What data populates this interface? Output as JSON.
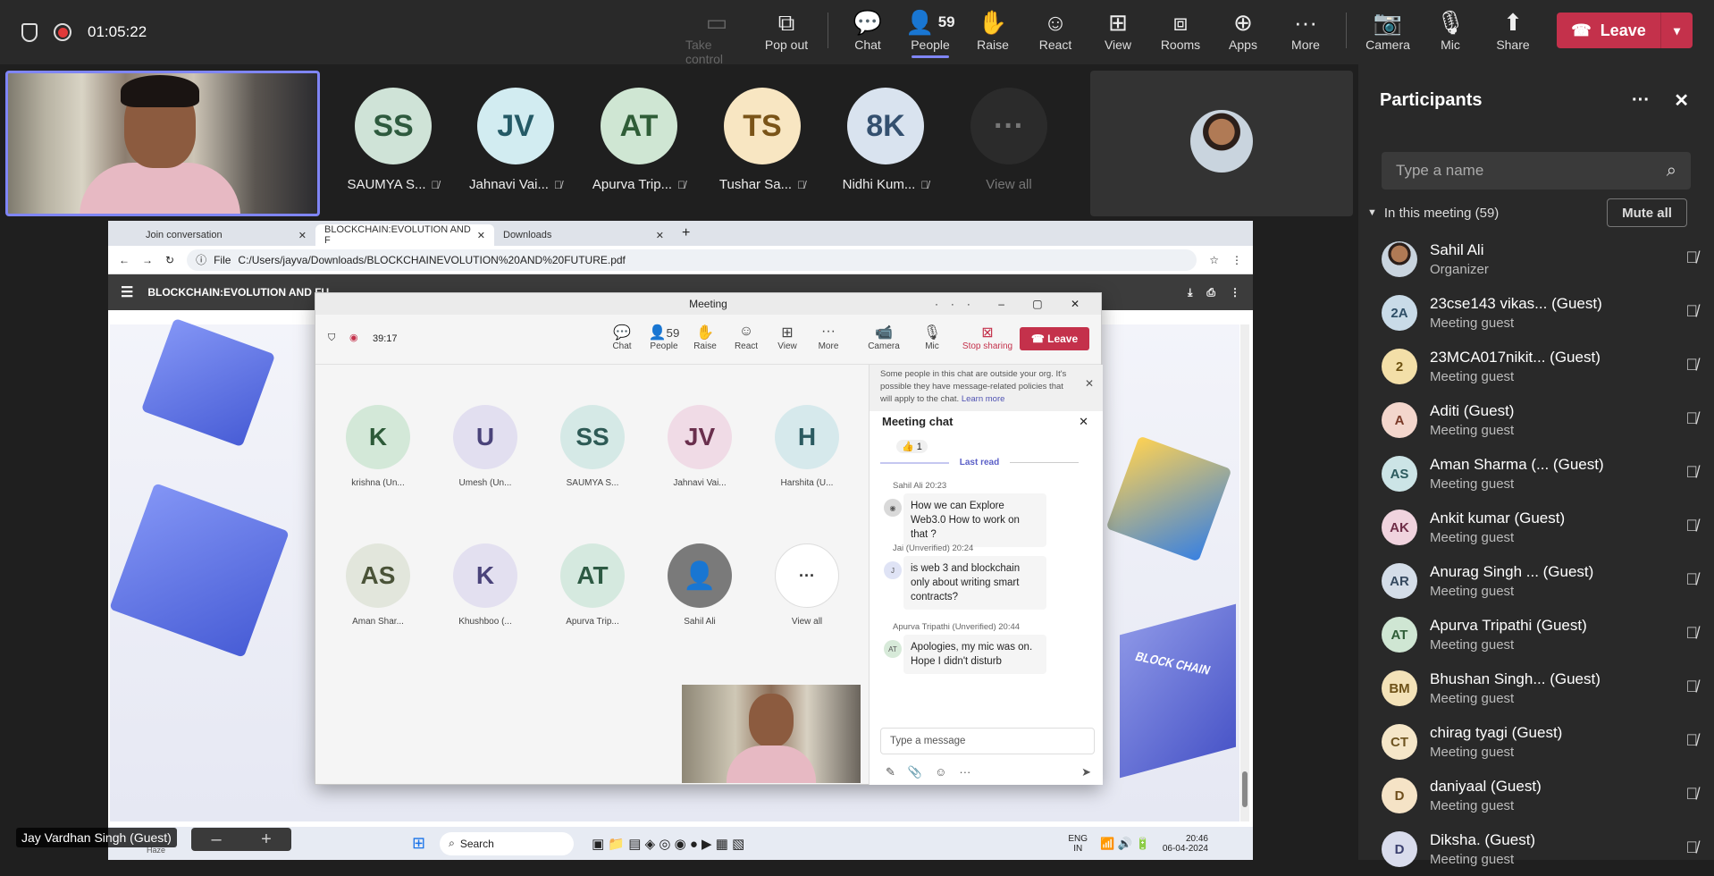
{
  "top": {
    "timer": "01:05:22",
    "take_control": "Take control",
    "pop_out": "Pop out",
    "chat": "Chat",
    "people": "People",
    "people_count": "59",
    "raise": "Raise",
    "react": "React",
    "view": "View",
    "rooms": "Rooms",
    "apps": "Apps",
    "more": "More",
    "camera": "Camera",
    "mic": "Mic",
    "share": "Share",
    "leave": "Leave"
  },
  "strip": [
    {
      "initials": "SS",
      "name": "SAUMYA S...",
      "bg": "#cfe3d7",
      "fg": "#2e5a3e"
    },
    {
      "initials": "JV",
      "name": "Jahnavi Vai...",
      "bg": "#d2ecf1",
      "fg": "#245a66"
    },
    {
      "initials": "AT",
      "name": "Apurva Trip...",
      "bg": "#cfe6d3",
      "fg": "#2f5d37"
    },
    {
      "initials": "TS",
      "name": "Tushar Sa...",
      "bg": "#f8e6c2",
      "fg": "#7a5418"
    },
    {
      "initials": "8K",
      "name": "Nidhi Kum...",
      "bg": "#d9e3ef",
      "fg": "#34506f"
    }
  ],
  "view_all": "View all",
  "self_name": "Jay Vardhan Singh (Guest)",
  "browser": {
    "tabs": [
      "Join conversation",
      "BLOCKCHAIN:EVOLUTION AND F",
      "Downloads"
    ],
    "file_label": "File",
    "url": "C:/Users/jayva/Downloads/BLOCKCHAINEVOLUTION%20AND%20FUTURE.pdf",
    "pdf_title": "BLOCKCHAIN:EVOLUTION AND FU",
    "slide_text": "BLOCK CHAIN"
  },
  "meeting": {
    "title": "Meeting",
    "timer": "39:17",
    "chat": "Chat",
    "people": "People",
    "count": "59",
    "raise": "Raise",
    "react": "React",
    "view": "View",
    "more": "More",
    "camera": "Camera",
    "mic": "Mic",
    "stop_sharing": "Stop sharing",
    "leave": "Leave",
    "grid": [
      {
        "initials": "K",
        "name": "krishna (Un...",
        "bg": "#d3e8d8",
        "fg": "#2d5a38"
      },
      {
        "initials": "U",
        "name": "Umesh (Un...",
        "bg": "#e2dff0",
        "fg": "#4a437a"
      },
      {
        "initials": "SS",
        "name": "SAUMYA S...",
        "bg": "#d5e9e6",
        "fg": "#2d5a55"
      },
      {
        "initials": "JV",
        "name": "Jahnavi Vai...",
        "bg": "#f0dbe6",
        "fg": "#6a2f4d"
      },
      {
        "initials": "H",
        "name": "Harshita (U...",
        "bg": "#d6e9ec",
        "fg": "#2a5a60"
      },
      {
        "initials": "AS",
        "name": "Aman Shar...",
        "bg": "#e2e6dc",
        "fg": "#4a5338"
      },
      {
        "initials": "K",
        "name": "Khushboo (...",
        "bg": "#e3e0f0",
        "fg": "#4a437a"
      },
      {
        "initials": "AT",
        "name": "Apurva Trip...",
        "bg": "#d5e9df",
        "fg": "#2d5a43"
      },
      {
        "initials": "",
        "name": "Sahil Ali",
        "bg": "#7a7a7a",
        "fg": "#ffffff"
      },
      {
        "initials": "···",
        "name": "View all",
        "bg": "#ffffff",
        "fg": "#333333"
      }
    ],
    "notice": "Some people in this chat are outside your org. It's possible they have message-related policies that will apply to the chat.",
    "learn_more": "Learn more",
    "chat_title": "Meeting chat",
    "reaction": "👍 1",
    "last_read": "Last read",
    "messages": [
      {
        "meta": "Sahil Ali  20:23",
        "text": "How we can Explore Web3.0 How to work on that ?",
        "av": ""
      },
      {
        "meta": "Jai (Unverified)  20:24",
        "text": "is web 3 and blockchain only about writing smart contracts?",
        "av": "J"
      },
      {
        "meta": "Apurva Tripathi (Unverified)  20:44",
        "text": "Apologies, my mic was on. Hope I didn't disturb",
        "av": "AT"
      }
    ],
    "compose_placeholder": "Type a message"
  },
  "taskbar": {
    "search": "Search",
    "lang": "ENG",
    "region": "IN",
    "time": "20:46",
    "date": "06-04-2024",
    "weather": "Haze"
  },
  "panel": {
    "title": "Participants",
    "search_placeholder": "Type a name",
    "section": "In this meeting (59)",
    "mute_all": "Mute all",
    "rows": [
      {
        "initials": "",
        "name": "Sahil Ali",
        "role": "Organizer",
        "bg": "#555",
        "fg": "#fff"
      },
      {
        "initials": "2A",
        "name": "23cse143 vikas... (Guest)",
        "role": "Meeting guest",
        "bg": "#c9dbe8",
        "fg": "#2e4e66"
      },
      {
        "initials": "2",
        "name": "23MCA017nikit... (Guest)",
        "role": "Meeting guest",
        "bg": "#f3dfa8",
        "fg": "#6e5212"
      },
      {
        "initials": "A",
        "name": "Aditi (Guest)",
        "role": "Meeting guest",
        "bg": "#f3d6cc",
        "fg": "#7a3a28"
      },
      {
        "initials": "AS",
        "name": "Aman Sharma (... (Guest)",
        "role": "Meeting guest",
        "bg": "#cce4e6",
        "fg": "#2c5a5e"
      },
      {
        "initials": "AK",
        "name": "Ankit kumar (Guest)",
        "role": "Meeting guest",
        "bg": "#f0d3de",
        "fg": "#6f2d47"
      },
      {
        "initials": "AR",
        "name": "Anurag Singh ... (Guest)",
        "role": "Meeting guest",
        "bg": "#d4dde8",
        "fg": "#35495f"
      },
      {
        "initials": "AT",
        "name": "Apurva Tripathi (Guest)",
        "role": "Meeting guest",
        "bg": "#cfe6d3",
        "fg": "#2f5d37"
      },
      {
        "initials": "BM",
        "name": "Bhushan Singh... (Guest)",
        "role": "Meeting guest",
        "bg": "#f3e2b8",
        "fg": "#6e5218"
      },
      {
        "initials": "CT",
        "name": "chirag tyagi (Guest)",
        "role": "Meeting guest",
        "bg": "#f5e6c8",
        "fg": "#6e5420"
      },
      {
        "initials": "D",
        "name": "daniyaal (Guest)",
        "role": "Meeting guest",
        "bg": "#f5e3c6",
        "fg": "#6e4e1c"
      },
      {
        "initials": "D",
        "name": "Diksha. (Guest)",
        "role": "Meeting guest",
        "bg": "#d9dcec",
        "fg": "#3c4170"
      }
    ]
  }
}
